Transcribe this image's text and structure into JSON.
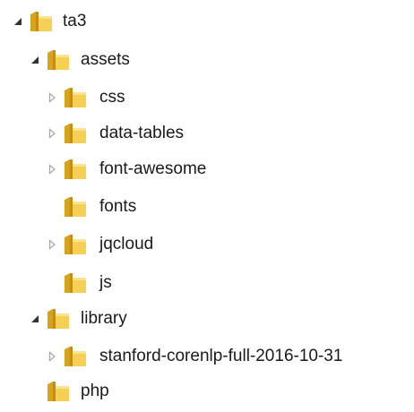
{
  "tree": {
    "items": [
      {
        "label": "ta3",
        "state": "expanded"
      },
      {
        "label": "assets",
        "state": "expanded"
      },
      {
        "label": "css",
        "state": "collapsed"
      },
      {
        "label": "data-tables",
        "state": "collapsed"
      },
      {
        "label": "font-awesome",
        "state": "collapsed"
      },
      {
        "label": "fonts",
        "state": "leaf"
      },
      {
        "label": "jqcloud",
        "state": "collapsed"
      },
      {
        "label": "js",
        "state": "leaf"
      },
      {
        "label": "library",
        "state": "expanded"
      },
      {
        "label": "stanford-corenlp-full-2016-10-31",
        "state": "collapsed"
      },
      {
        "label": "php",
        "state": "leaf"
      }
    ]
  },
  "icons": {
    "expanded": "expanded-arrow-icon",
    "collapsed": "collapsed-arrow-icon",
    "folder": "folder-icon"
  },
  "colors": {
    "folder_back": "#d9a21b",
    "folder_front": "#f6cf55",
    "folder_light": "#fbe38f",
    "arrow_expanded": "#333333",
    "arrow_collapsed": "#a6a6a6"
  }
}
